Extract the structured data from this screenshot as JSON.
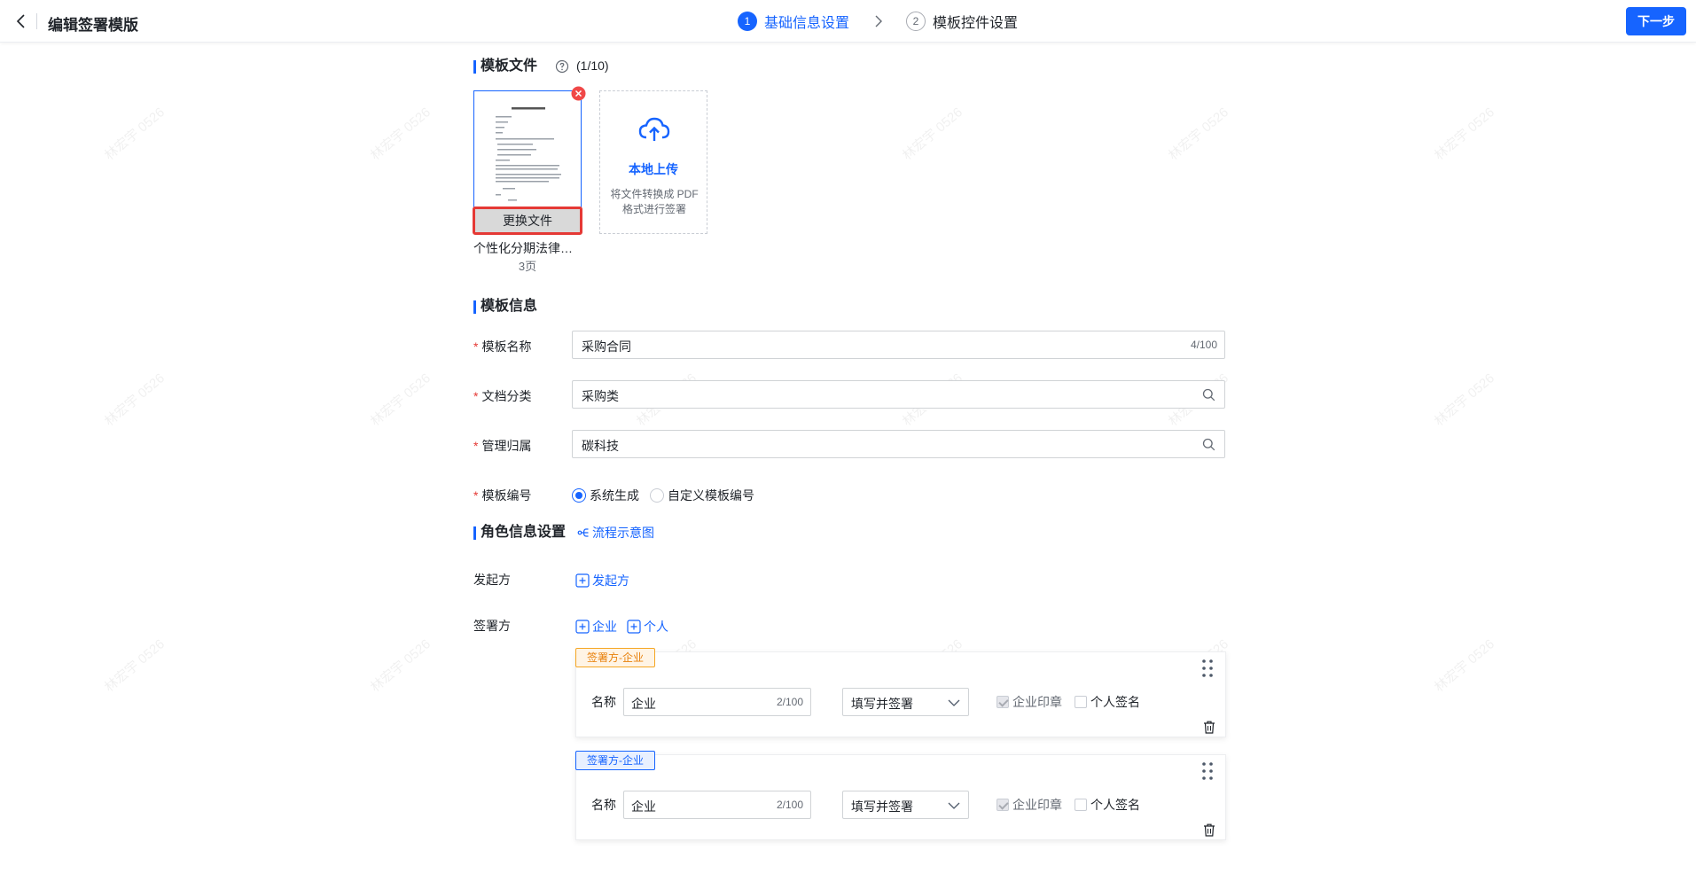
{
  "header": {
    "title": "编辑签署模版",
    "steps": [
      {
        "num": "1",
        "label": "基础信息设置",
        "active": true
      },
      {
        "num": "2",
        "label": "模板控件设置",
        "active": false
      }
    ],
    "next_label": "下一步"
  },
  "watermark": "林宏宇 0526",
  "template_file": {
    "title": "模板文件",
    "count": "(1/10)",
    "file": {
      "doc_heading": "个性化分期法律…",
      "name": "个性化分期法律…",
      "pages": "3页",
      "replace_label": "更换文件"
    },
    "upload": {
      "title": "本地上传",
      "hint": "将文件转换成 PDF 格式进行签署"
    }
  },
  "template_info": {
    "title": "模板信息",
    "name": {
      "label": "模板名称",
      "value": "采购合同",
      "count": "4/100"
    },
    "category": {
      "label": "文档分类",
      "value": "采购类"
    },
    "owner": {
      "label": "管理归属",
      "value": "碳科技"
    },
    "code": {
      "label": "模板编号",
      "options": [
        {
          "label": "系统生成",
          "selected": true
        },
        {
          "label": "自定义模板编号",
          "selected": false
        }
      ]
    }
  },
  "roles": {
    "title": "角色信息设置",
    "flow_link": "流程示意图",
    "initiator_label": "发起方",
    "initiator_add": "发起方",
    "signer_label": "签署方",
    "add_enterprise": "企业",
    "add_person": "个人",
    "signers": [
      {
        "tag": "签署方-企业",
        "name_label": "名称",
        "name_value": "企业",
        "name_count": "2/100",
        "action": "填写并签署",
        "seal_label": "企业印章",
        "personal_label": "个人签名"
      },
      {
        "tag": "签署方-企业",
        "name_label": "名称",
        "name_value": "企业",
        "name_count": "2/100",
        "action": "填写并签署",
        "seal_label": "企业印章",
        "personal_label": "个人签名"
      }
    ]
  },
  "colors": {
    "primary": "#1664ff",
    "danger": "#e53935",
    "tag_orange": "#f5a623"
  }
}
